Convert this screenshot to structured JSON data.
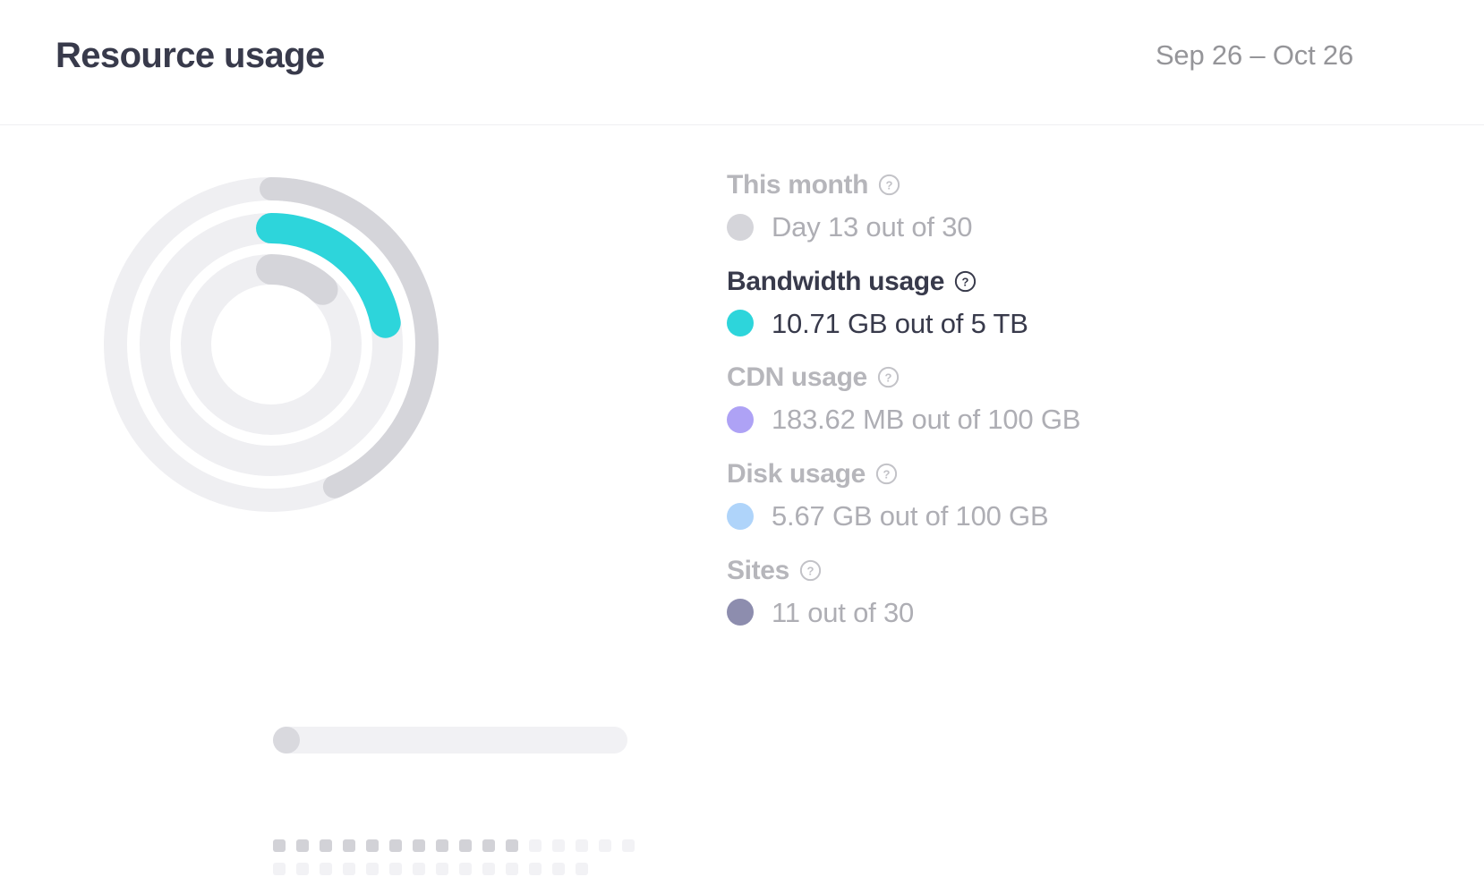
{
  "header": {
    "title": "Resource usage",
    "date_range": "Sep 26 – Oct 26"
  },
  "legend": {
    "groups": [
      {
        "label": "This month",
        "value": "Day 13 out of 30",
        "dot_color": "#D5D5DA",
        "active": false,
        "help_icon": "question-circle-icon"
      },
      {
        "label": "Bandwidth usage",
        "value": "10.71 GB out of 5 TB",
        "dot_color": "#2DD5DB",
        "active": true,
        "help_icon": "question-circle-icon"
      },
      {
        "label": "CDN usage",
        "value": "183.62 MB out of 100 GB",
        "dot_color": "#AEA2F5",
        "active": false,
        "help_icon": "question-circle-icon"
      },
      {
        "label": "Disk usage",
        "value": "5.67 GB out of 100 GB",
        "dot_color": "#AFD4FA",
        "active": false,
        "help_icon": "question-circle-icon"
      },
      {
        "label": "Sites",
        "value": "11 out of 30",
        "dot_color": "#8D8DAE",
        "active": false,
        "help_icon": "question-circle-icon"
      }
    ]
  },
  "chart_data": {
    "type": "pie",
    "title": "Resource usage",
    "subtitle": "Sep 26 – Oct 26",
    "legend_position": "right",
    "grid": false,
    "rings": [
      {
        "name": "This month",
        "ring": "outer",
        "value": 13,
        "max": 30,
        "percent": 43.3,
        "unit": "days",
        "display": "Day 13 out of 30",
        "color": "#D5D5DA",
        "track_color": "#EFEFF2"
      },
      {
        "name": "Bandwidth usage",
        "ring": "middle",
        "value": 10.71,
        "max": 5120,
        "percent": 22.0,
        "unit": "GB",
        "display": "10.71 GB out of 5 TB",
        "color": "#2DD5DB",
        "track_color": "#EFEFF2"
      },
      {
        "name": "CDN usage",
        "ring": "inner",
        "value": 183.62,
        "max": 102400,
        "percent": 12.0,
        "unit": "MB",
        "display": "183.62 MB out of 100 GB",
        "color": "#D5D5DA",
        "track_color": "#EFEFF2"
      }
    ],
    "bar": {
      "name": "Disk usage",
      "value": 5.67,
      "max": 100,
      "percent": 5.67,
      "unit": "GB",
      "display": "5.67 GB out of 100 GB",
      "color": "#D9D9DE",
      "track_color": "#F1F1F4"
    },
    "squares": {
      "name": "Sites",
      "value": 11,
      "max": 30,
      "filled": 11,
      "total": 30,
      "display": "11 out of 30",
      "color": "#D2D2D7",
      "track_color": "#F2F2F5"
    }
  }
}
